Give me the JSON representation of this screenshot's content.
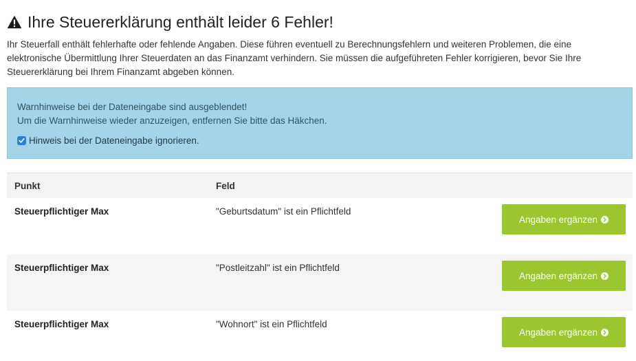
{
  "header": {
    "icon": "warning-icon",
    "title": "Ihre Steuererklärung enthält leider 6 Fehler!"
  },
  "intro": {
    "text": "Ihr Steuerfall enthält fehlerhafte oder fehlende Angaben. Diese führen eventuell zu Berechnungsfehlern und weiteren Problemen, die eine elektronische Übermittlung Ihrer Steuerdaten an das Finanzamt verhindern. Sie müssen die aufgeführeten Fehler korrigieren, bevor Sie Ihre Steuererklärung bei Ihrem Finanzamt abgeben können."
  },
  "alert": {
    "line1": "Warnhinweise bei der Dateneingabe sind ausgeblendet!",
    "line2": "Um die Warnhinweise wieder anzuzeigen, entfernen Sie bitte das Häkchen.",
    "checkbox_label": "Hinweis bei der Dateneingabe ignorieren.",
    "checkbox_checked": true
  },
  "table": {
    "headers": {
      "punkt": "Punkt",
      "feld": "Feld"
    },
    "rows": [
      {
        "punkt": "Steuerpflichtiger Max",
        "feld": "\"Geburtsdatum\" ist ein Pflichtfeld",
        "button": "Angaben ergänzen"
      },
      {
        "punkt": "Steuerpflichtiger Max",
        "feld": "\"Postleitzahl\" ist ein Pflichtfeld",
        "button": "Angaben ergänzen"
      },
      {
        "punkt": "Steuerpflichtiger Max",
        "feld": "\"Wohnort\" ist ein Pflichtfeld",
        "button": "Angaben ergänzen"
      }
    ]
  },
  "colors": {
    "alert_bg": "#a3d4e8",
    "button_bg": "#9bc62e",
    "checkbox": "#2f7fd8"
  }
}
